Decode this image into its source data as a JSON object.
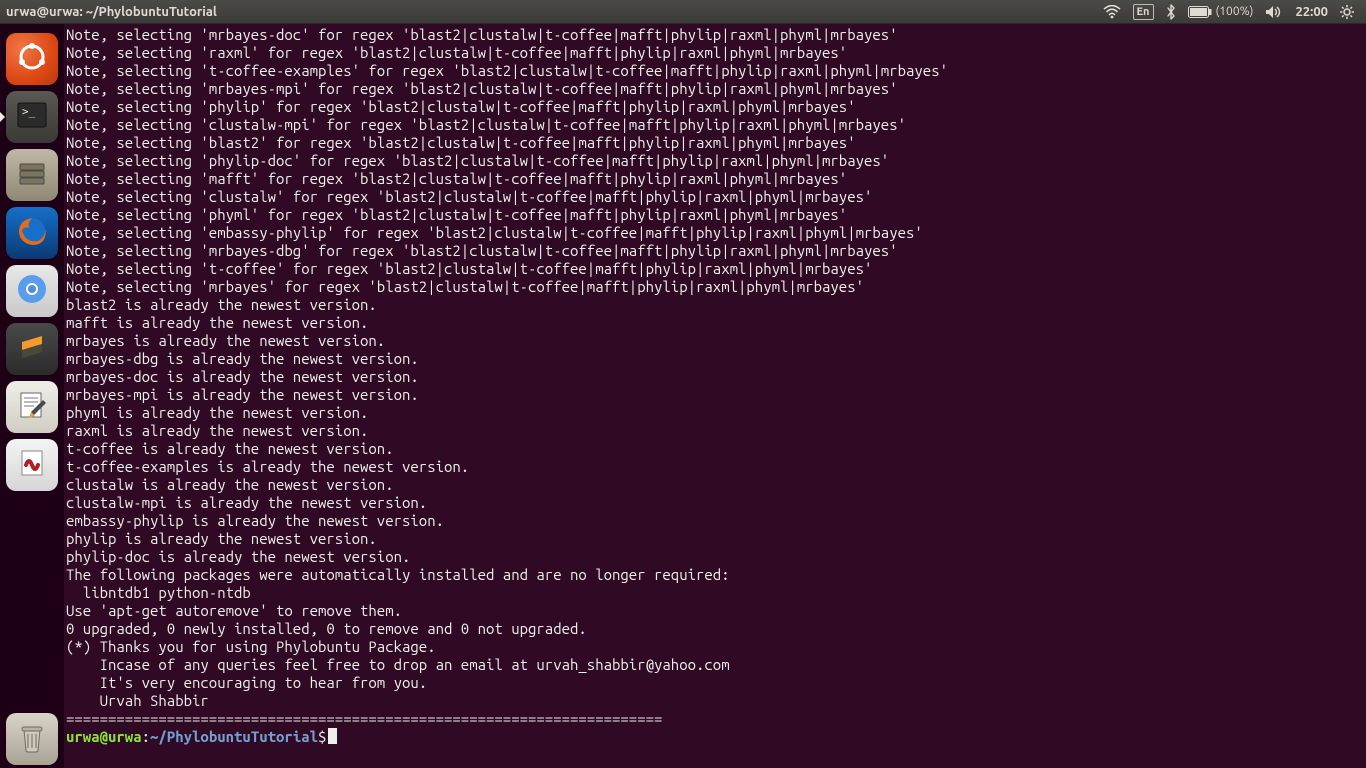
{
  "panel": {
    "title": "urwa@urwa: ~/PhylobuntuTutorial",
    "lang": "En",
    "battery": "(100%)",
    "time": "22:00"
  },
  "launcher": {
    "items": [
      {
        "name": "dash",
        "label": "Dash",
        "active": false,
        "cls": "li-ubuntu"
      },
      {
        "name": "terminal",
        "label": "Terminal",
        "active": true,
        "cls": "li-dark"
      },
      {
        "name": "files",
        "label": "Files",
        "active": false,
        "cls": "li-files"
      },
      {
        "name": "firefox",
        "label": "Firefox",
        "active": false,
        "cls": "li-firefox"
      },
      {
        "name": "chromium",
        "label": "Chromium",
        "active": false,
        "cls": "li-chrome"
      },
      {
        "name": "sublime",
        "label": "Sublime Text",
        "active": false,
        "cls": "li-subl"
      },
      {
        "name": "gedit",
        "label": "Text Editor",
        "active": false,
        "cls": "li-gedit"
      },
      {
        "name": "evince",
        "label": "Document Viewer",
        "active": false,
        "cls": "li-evince"
      }
    ],
    "trash_label": "Trash"
  },
  "terminal": {
    "lines": [
      "Note, selecting 'mrbayes-doc' for regex 'blast2|clustalw|t-coffee|mafft|phylip|raxml|phyml|mrbayes'",
      "Note, selecting 'raxml' for regex 'blast2|clustalw|t-coffee|mafft|phylip|raxml|phyml|mrbayes'",
      "Note, selecting 't-coffee-examples' for regex 'blast2|clustalw|t-coffee|mafft|phylip|raxml|phyml|mrbayes'",
      "Note, selecting 'mrbayes-mpi' for regex 'blast2|clustalw|t-coffee|mafft|phylip|raxml|phyml|mrbayes'",
      "Note, selecting 'phylip' for regex 'blast2|clustalw|t-coffee|mafft|phylip|raxml|phyml|mrbayes'",
      "Note, selecting 'clustalw-mpi' for regex 'blast2|clustalw|t-coffee|mafft|phylip|raxml|phyml|mrbayes'",
      "Note, selecting 'blast2' for regex 'blast2|clustalw|t-coffee|mafft|phylip|raxml|phyml|mrbayes'",
      "Note, selecting 'phylip-doc' for regex 'blast2|clustalw|t-coffee|mafft|phylip|raxml|phyml|mrbayes'",
      "Note, selecting 'mafft' for regex 'blast2|clustalw|t-coffee|mafft|phylip|raxml|phyml|mrbayes'",
      "Note, selecting 'clustalw' for regex 'blast2|clustalw|t-coffee|mafft|phylip|raxml|phyml|mrbayes'",
      "Note, selecting 'phyml' for regex 'blast2|clustalw|t-coffee|mafft|phylip|raxml|phyml|mrbayes'",
      "Note, selecting 'embassy-phylip' for regex 'blast2|clustalw|t-coffee|mafft|phylip|raxml|phyml|mrbayes'",
      "Note, selecting 'mrbayes-dbg' for regex 'blast2|clustalw|t-coffee|mafft|phylip|raxml|phyml|mrbayes'",
      "Note, selecting 't-coffee' for regex 'blast2|clustalw|t-coffee|mafft|phylip|raxml|phyml|mrbayes'",
      "Note, selecting 'mrbayes' for regex 'blast2|clustalw|t-coffee|mafft|phylip|raxml|phyml|mrbayes'",
      "blast2 is already the newest version.",
      "mafft is already the newest version.",
      "mrbayes is already the newest version.",
      "mrbayes-dbg is already the newest version.",
      "mrbayes-doc is already the newest version.",
      "mrbayes-mpi is already the newest version.",
      "phyml is already the newest version.",
      "raxml is already the newest version.",
      "t-coffee is already the newest version.",
      "t-coffee-examples is already the newest version.",
      "clustalw is already the newest version.",
      "clustalw-mpi is already the newest version.",
      "embassy-phylip is already the newest version.",
      "phylip is already the newest version.",
      "phylip-doc is already the newest version.",
      "The following packages were automatically installed and are no longer required:",
      "  libntdb1 python-ntdb",
      "Use 'apt-get autoremove' to remove them.",
      "0 upgraded, 0 newly installed, 0 to remove and 0 not upgraded.",
      "(*) Thanks you for using Phylobuntu Package.",
      "    Incase of any queries feel free to drop an email at urvah_shabbir@yahoo.com",
      "    It's very encouraging to hear from you.",
      "",
      "    Urvah Shabbir",
      "======================================================================="
    ],
    "prompt": {
      "userhost": "urwa@urwa",
      "colon": ":",
      "path": "~/PhylobuntuTutorial",
      "dollar": "$"
    }
  }
}
